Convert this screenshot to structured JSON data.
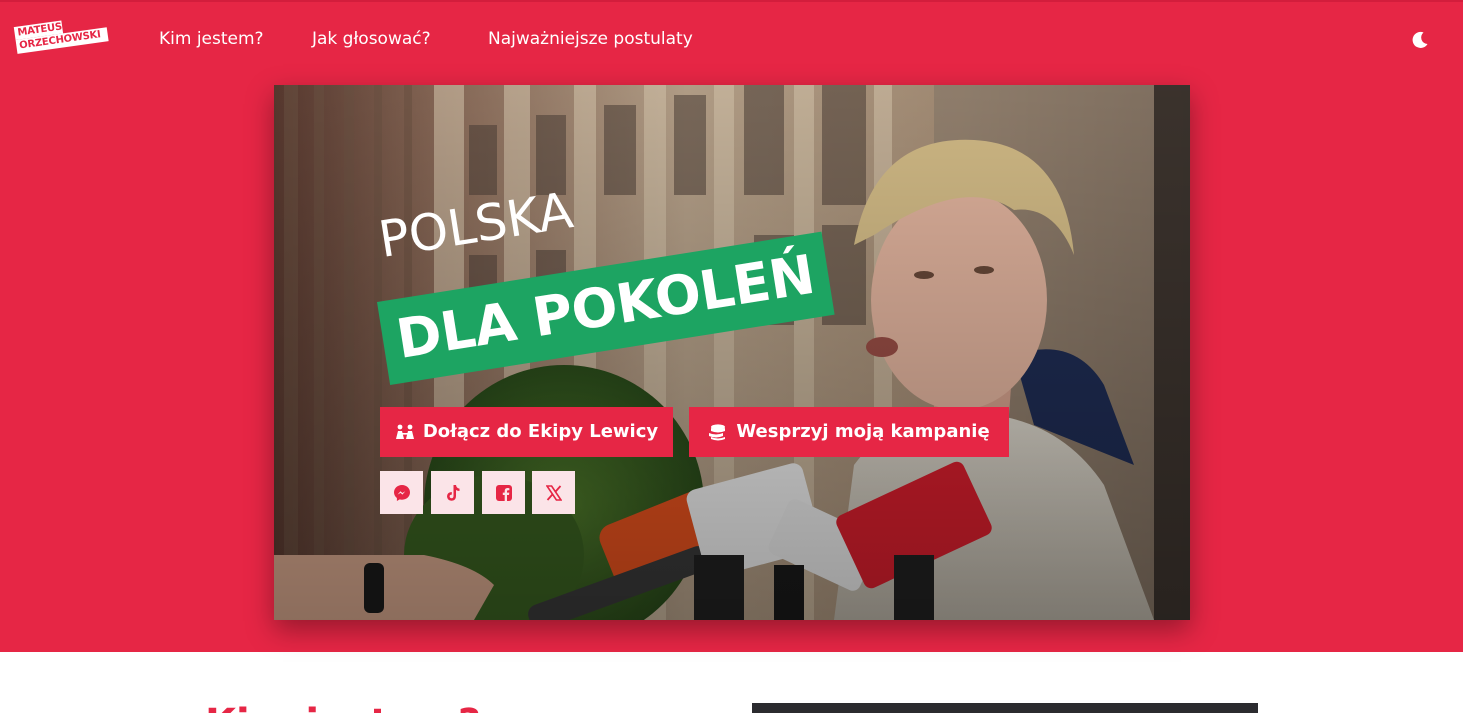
{
  "colors": {
    "brand_red": "#e62645",
    "brand_green": "#1da462",
    "social_bg": "#fbe4e8",
    "dark_panel": "#2b2b2f"
  },
  "nav": {
    "logo_line1": "MATEUSZ",
    "logo_line2": "ORZECHOWSKI",
    "links": [
      {
        "label": "Kim jestem?"
      },
      {
        "label": "Jak głosować?"
      },
      {
        "label": "Najważniejsze postulaty"
      }
    ],
    "theme_toggle_icon": "moon-icon"
  },
  "hero": {
    "headline_line1": "POLSKA",
    "headline_line2": "DLA POKOLEŃ",
    "buttons": [
      {
        "label": "Dołącz do Ekipy Lewicy",
        "icon": "people-icon"
      },
      {
        "label": "Wesprzyj moją kampanię",
        "icon": "coins-icon"
      }
    ],
    "socials": [
      {
        "icon": "messenger-icon"
      },
      {
        "icon": "tiktok-icon"
      },
      {
        "icon": "facebook-icon"
      },
      {
        "icon": "x-icon"
      }
    ]
  },
  "section": {
    "heading": "Kim jestem?"
  }
}
